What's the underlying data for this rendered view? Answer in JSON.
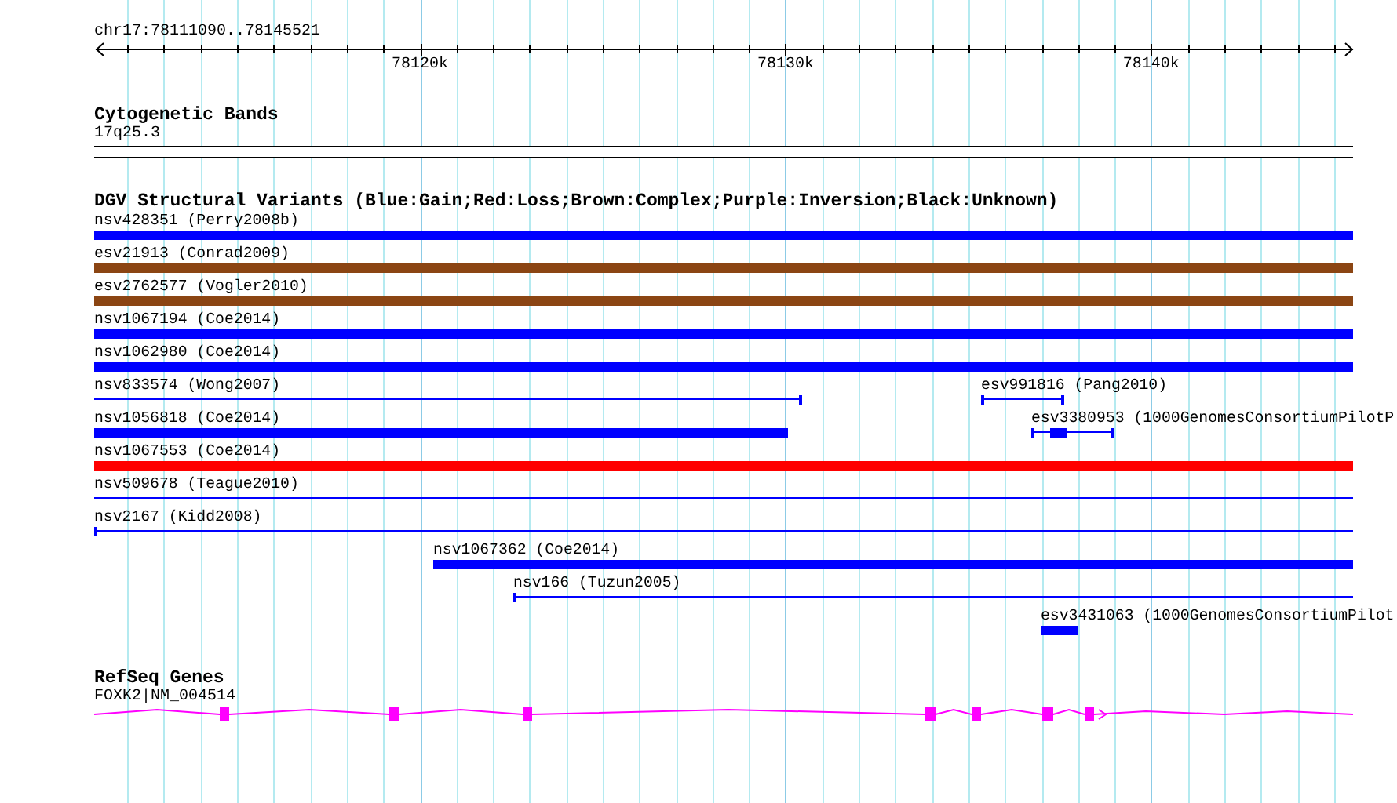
{
  "ruler": {
    "location": "chr17:78111090..78145521",
    "tick_labels": [
      "78120k",
      "78130k",
      "78140k"
    ]
  },
  "cytogenetic_bands": {
    "title": "Cytogenetic Bands",
    "band": "17q25.3"
  },
  "structural_variants": {
    "title": "DGV Structural Variants (Blue:Gain;Red:Loss;Brown:Complex;Purple:Inversion;Black:Unknown)",
    "rows": [
      {
        "features": [
          {
            "label": "nsv428351 (Perry2008b)",
            "kind": "bar",
            "color": "#0000ff"
          }
        ]
      },
      {
        "features": [
          {
            "label": "esv21913 (Conrad2009)",
            "kind": "bar",
            "color": "#8b4513"
          }
        ]
      },
      {
        "features": [
          {
            "label": "esv2762577 (Vogler2010)",
            "kind": "bar",
            "color": "#8b4513"
          }
        ]
      },
      {
        "features": [
          {
            "label": "nsv1067194 (Coe2014)",
            "kind": "bar",
            "color": "#0000ff"
          }
        ]
      },
      {
        "features": [
          {
            "label": "nsv1062980 (Coe2014)",
            "kind": "bar",
            "color": "#0000ff"
          }
        ]
      },
      {
        "features": [
          {
            "label": "nsv833574 (Wong2007)",
            "kind": "line",
            "color": "#0000ff"
          },
          {
            "label": "esv991816 (Pang2010)",
            "kind": "line",
            "color": "#0000ff"
          }
        ]
      },
      {
        "features": [
          {
            "label": "nsv1056818 (Coe2014)",
            "kind": "bar",
            "color": "#0000ff"
          },
          {
            "label": "esv3380953 (1000GenomesConsortiumPilotP",
            "kind": "line",
            "color": "#0000ff"
          }
        ]
      },
      {
        "features": [
          {
            "label": "nsv1067553 (Coe2014)",
            "kind": "bar",
            "color": "#ff0000"
          }
        ]
      },
      {
        "features": [
          {
            "label": "nsv509678 (Teague2010)",
            "kind": "line",
            "color": "#0000ff"
          }
        ]
      },
      {
        "features": [
          {
            "label": "nsv2167 (Kidd2008)",
            "kind": "line",
            "color": "#0000ff"
          }
        ]
      },
      {
        "features": [
          {
            "label": "nsv1067362 (Coe2014)",
            "kind": "bar",
            "color": "#0000ff"
          }
        ]
      },
      {
        "features": [
          {
            "label": "nsv166 (Tuzun2005)",
            "kind": "line",
            "color": "#0000ff"
          }
        ]
      },
      {
        "features": [
          {
            "label": "esv3431063 (1000GenomesConsortiumPilot",
            "kind": "bar",
            "color": "#0000ff"
          }
        ]
      }
    ]
  },
  "refseq_genes": {
    "title": "RefSeq Genes",
    "gene": "FOXK2|NM_004514"
  }
}
